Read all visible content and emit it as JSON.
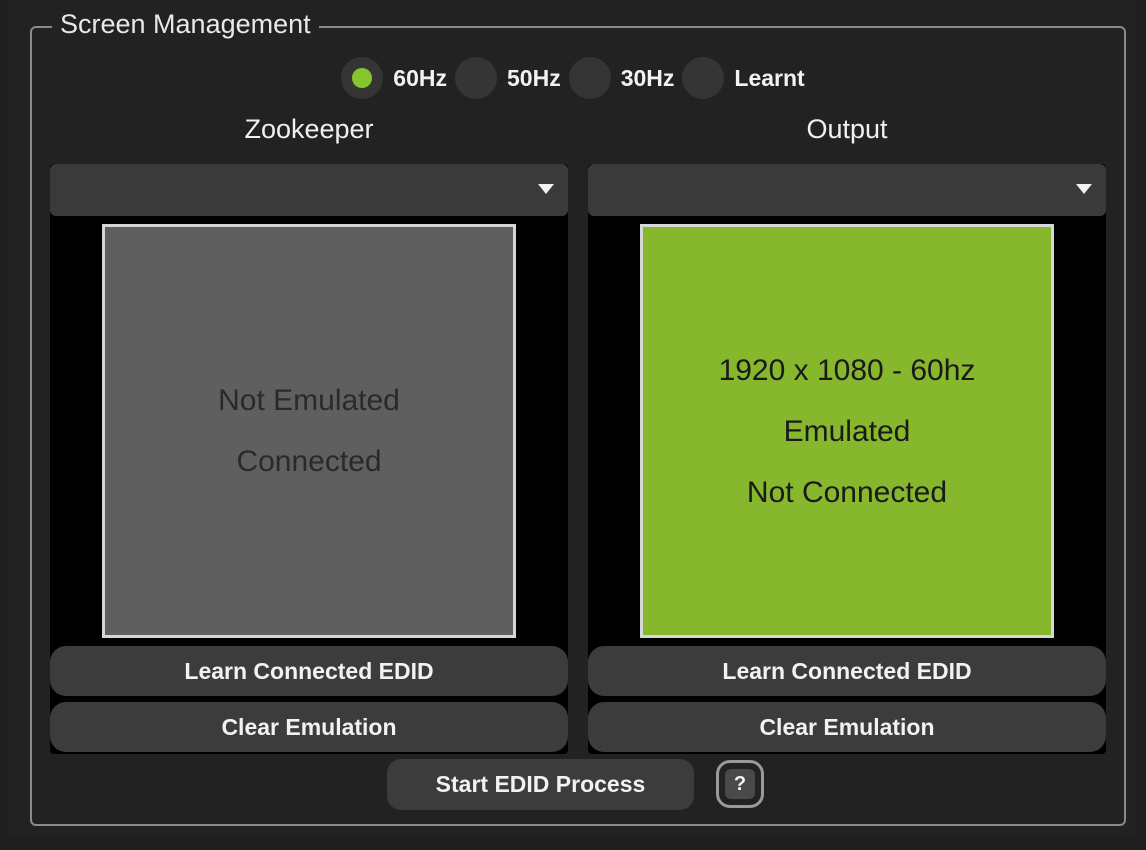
{
  "groupbox": {
    "title": "Screen Management"
  },
  "frequency": {
    "options": [
      {
        "label": "60Hz",
        "selected": true
      },
      {
        "label": "50Hz",
        "selected": false
      },
      {
        "label": "30Hz",
        "selected": false
      },
      {
        "label": "Learnt",
        "selected": false
      }
    ],
    "selected_color": "#86c52c"
  },
  "zookeeper": {
    "title": "Zookeeper",
    "dropdown_value": "",
    "status": {
      "resolution": "",
      "emulation": "Not Emulated",
      "connection": "Connected",
      "color": "#5f5f5f"
    },
    "learn_label": "Learn Connected EDID",
    "clear_label": "Clear Emulation"
  },
  "output": {
    "title": "Output",
    "dropdown_value": "",
    "status": {
      "resolution": "1920 x 1080 - 60hz",
      "emulation": "Emulated",
      "connection": "Not Connected",
      "color": "#86b72c"
    },
    "learn_label": "Learn Connected EDID",
    "clear_label": "Clear Emulation"
  },
  "footer": {
    "start_label": "Start EDID Process",
    "help_label": "?"
  }
}
